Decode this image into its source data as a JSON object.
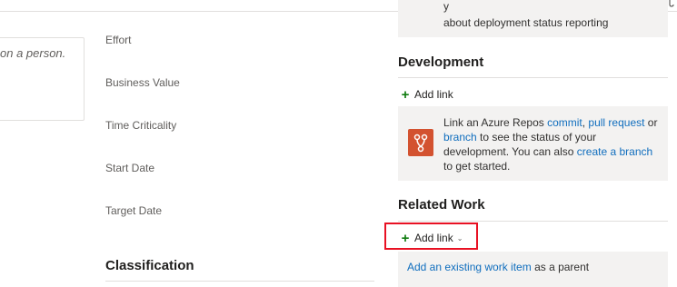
{
  "top_tabs": {
    "icons": [
      "history-icon",
      "link-icon",
      "attachment-icon"
    ]
  },
  "description": {
    "placeholder": "on a person."
  },
  "fields": {
    "effort": "Effort",
    "business_value": "Business Value",
    "time_criticality": "Time Criticality",
    "start_date": "Start Date",
    "target_date": "Target Date"
  },
  "classification": {
    "title": "Classification"
  },
  "deployment": {
    "partial_line": "y",
    "link_text": "about deployment status reporting"
  },
  "development": {
    "title": "Development",
    "add_link_label": "Add link",
    "message_prefix": "Link an Azure Repos ",
    "commit_link": "commit",
    "sep1": ", ",
    "pull_request_link": "pull request",
    "sep2": " or",
    "branch_link": "branch",
    "message_mid": " to see the status of your development. You can also ",
    "create_branch_link": "create a branch",
    "message_suffix": "to get started.",
    "icon": "git-branch-icon"
  },
  "related_work": {
    "title": "Related Work",
    "add_link_label": "Add link",
    "existing_item_link": "Add an existing work item",
    "existing_item_suffix": " as a parent"
  },
  "colors": {
    "accent_link": "#106ebe",
    "plus_green": "#107c10",
    "highlight_red": "#e81123",
    "repo_icon_orange": "#d35230",
    "panel_grey": "#f3f2f1"
  }
}
